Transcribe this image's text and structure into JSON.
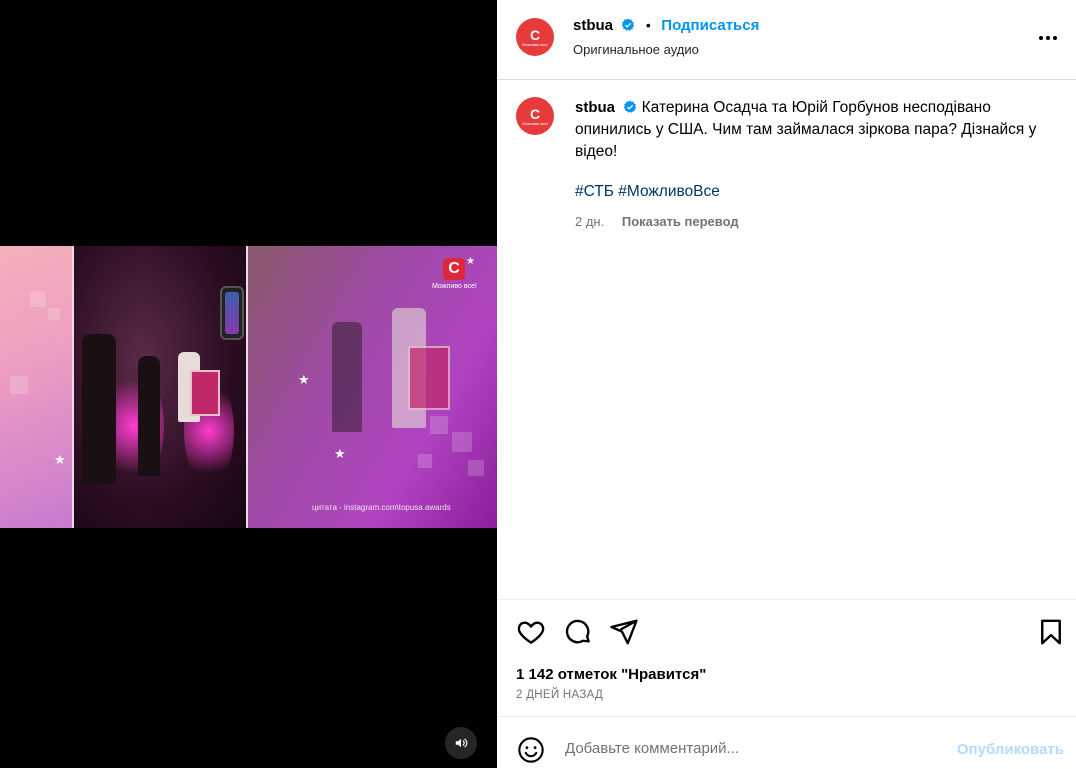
{
  "video": {
    "logo_letter": "С",
    "logo_text": "Можливо все!",
    "caption": "цитата - instagram.com\\topusa.awards",
    "audio_icon": "speaker-icon"
  },
  "header": {
    "avatar_letter": "С",
    "avatar_sub": "Можливо все!",
    "username": "stbua",
    "separator": "•",
    "follow_label": "Подписаться",
    "audio_label": "Оригинальное аудио",
    "more_icon": "more-options-icon"
  },
  "post": {
    "username": "stbua",
    "caption": "Катерина Осадча та Юрій Горбунов несподівано опинились у США. Чим там займалася зіркова пара? Дізнайся у відео!",
    "hashtags": [
      "#СТБ",
      "#МожливоВсе"
    ],
    "time_ago": "2 дн.",
    "translate_label": "Показать перевод"
  },
  "actions": {
    "like_icon": "heart-icon",
    "comment_icon": "comment-icon",
    "share_icon": "share-icon",
    "save_icon": "bookmark-icon",
    "likes_text": "1 142 отметок \"Нравится\"",
    "date_text": "2 ДНЕЙ НАЗАД"
  },
  "comment": {
    "emoji_icon": "emoji-icon",
    "placeholder": "Добавьте комментарий...",
    "publish_label": "Опубликовать"
  },
  "colors": {
    "accent": "#0095f6",
    "brand_red": "#e0263a",
    "publish_disabled": "#b3dbff",
    "hashtag": "#00376b"
  }
}
